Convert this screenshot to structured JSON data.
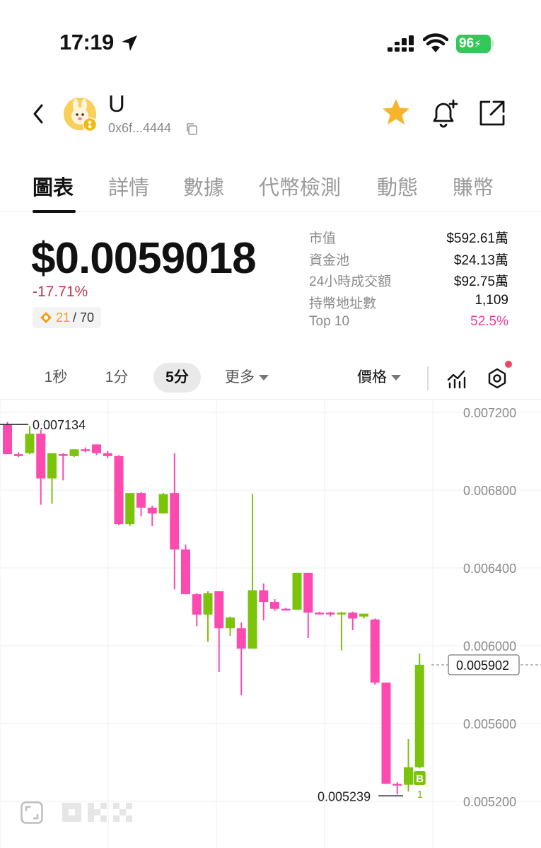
{
  "status_bar": {
    "time": "17:19",
    "battery": "96"
  },
  "token": {
    "name": "U",
    "address": "0x6f...4444"
  },
  "tabs": [
    {
      "label": "圖表",
      "active": true
    },
    {
      "label": "詳情"
    },
    {
      "label": "數據"
    },
    {
      "label": "代幣檢測"
    },
    {
      "label": "動態"
    },
    {
      "label": "賺幣"
    }
  ],
  "price": {
    "value": "$0.0059018",
    "change": "-17.71%",
    "score": "21",
    "score_total": "/ 70"
  },
  "stats": [
    {
      "label": "市值",
      "value": "$592.61萬"
    },
    {
      "label": "資金池",
      "value": "$24.13萬"
    },
    {
      "label": "24小時成交額",
      "value": "$92.75萬"
    },
    {
      "label": "持幣地址數",
      "value": "1,109"
    },
    {
      "label": "Top 10",
      "value": "52.5%",
      "highlight": true
    }
  ],
  "toolbar": {
    "timeframes": [
      "1秒",
      "1分",
      "5分"
    ],
    "active_timeframe": "5分",
    "more_label": "更多",
    "price_label": "價格"
  },
  "colors": {
    "up": "#7cc30c",
    "down": "#fc4ab1",
    "accent_star": "#f7b52c"
  },
  "chart_data": {
    "type": "candlestick",
    "y_ticks": [
      "0.007200",
      "0.006800",
      "0.006400",
      "0.006000",
      "0.005600",
      "0.005200"
    ],
    "ylim": [
      0.00505,
      0.00727
    ],
    "high_label": "0.007134",
    "low_label": "0.005239",
    "last_price_label": "0.005902",
    "marker_label": "B",
    "marker_count": "1",
    "candles": [
      {
        "o": 0.00714,
        "h": 0.00715,
        "c": 0.006985,
        "l": 0.006985,
        "dir": "down"
      },
      {
        "o": 0.006985,
        "h": 0.006995,
        "c": 0.006975,
        "l": 0.00697,
        "dir": "down"
      },
      {
        "o": 0.00699,
        "h": 0.00713,
        "c": 0.00709,
        "l": 0.006985,
        "dir": "up"
      },
      {
        "o": 0.00709,
        "h": 0.00711,
        "c": 0.00686,
        "l": 0.006725,
        "dir": "down"
      },
      {
        "o": 0.00686,
        "h": 0.00699,
        "c": 0.00699,
        "l": 0.00673,
        "dir": "up"
      },
      {
        "o": 0.006985,
        "h": 0.00699,
        "c": 0.00698,
        "l": 0.00685,
        "dir": "down"
      },
      {
        "o": 0.006975,
        "h": 0.00701,
        "c": 0.00701,
        "l": 0.00697,
        "dir": "up"
      },
      {
        "o": 0.00701,
        "h": 0.00702,
        "c": 0.007005,
        "l": 0.006995,
        "dir": "down"
      },
      {
        "o": 0.007035,
        "h": 0.007035,
        "c": 0.00699,
        "l": 0.00698,
        "dir": "down"
      },
      {
        "o": 0.00699,
        "h": 0.007,
        "c": 0.006975,
        "l": 0.006965,
        "dir": "down"
      },
      {
        "o": 0.006975,
        "h": 0.00698,
        "c": 0.006625,
        "l": 0.00662,
        "dir": "down"
      },
      {
        "o": 0.006625,
        "h": 0.006785,
        "c": 0.006785,
        "l": 0.006615,
        "dir": "up"
      },
      {
        "o": 0.006785,
        "h": 0.00679,
        "c": 0.00671,
        "l": 0.006665,
        "dir": "down"
      },
      {
        "o": 0.00671,
        "h": 0.00672,
        "c": 0.00668,
        "l": 0.006615,
        "dir": "down"
      },
      {
        "o": 0.00668,
        "h": 0.006785,
        "c": 0.00678,
        "l": 0.00668,
        "dir": "up"
      },
      {
        "o": 0.006785,
        "h": 0.00699,
        "c": 0.006495,
        "l": 0.00629,
        "dir": "down"
      },
      {
        "o": 0.006495,
        "h": 0.00652,
        "c": 0.006265,
        "l": 0.006265,
        "dir": "down"
      },
      {
        "o": 0.006265,
        "h": 0.00627,
        "c": 0.00616,
        "l": 0.0061,
        "dir": "down"
      },
      {
        "o": 0.00616,
        "h": 0.00628,
        "c": 0.00627,
        "l": 0.00602,
        "dir": "up"
      },
      {
        "o": 0.00628,
        "h": 0.00628,
        "c": 0.00609,
        "l": 0.005865,
        "dir": "down"
      },
      {
        "o": 0.00609,
        "h": 0.00615,
        "c": 0.006145,
        "l": 0.00605,
        "dir": "up"
      },
      {
        "o": 0.00609,
        "h": 0.00612,
        "c": 0.005985,
        "l": 0.005745,
        "dir": "down"
      },
      {
        "o": 0.005985,
        "h": 0.00678,
        "c": 0.006285,
        "l": 0.005985,
        "dir": "up"
      },
      {
        "o": 0.006285,
        "h": 0.00632,
        "c": 0.006225,
        "l": 0.00613,
        "dir": "down"
      },
      {
        "o": 0.006225,
        "h": 0.00624,
        "c": 0.00619,
        "l": 0.00618,
        "dir": "down"
      },
      {
        "o": 0.00619,
        "h": 0.006195,
        "c": 0.006185,
        "l": 0.00618,
        "dir": "down"
      },
      {
        "o": 0.006185,
        "h": 0.006375,
        "c": 0.006375,
        "l": 0.006185,
        "dir": "up"
      },
      {
        "o": 0.006375,
        "h": 0.006375,
        "c": 0.00617,
        "l": 0.00604,
        "dir": "down"
      },
      {
        "o": 0.00617,
        "h": 0.006175,
        "c": 0.006165,
        "l": 0.00616,
        "dir": "down"
      },
      {
        "o": 0.00617,
        "h": 0.006175,
        "c": 0.006165,
        "l": 0.00615,
        "dir": "down"
      },
      {
        "o": 0.006165,
        "h": 0.006175,
        "c": 0.00617,
        "l": 0.005975,
        "dir": "up"
      },
      {
        "o": 0.00617,
        "h": 0.006175,
        "c": 0.00614,
        "l": 0.00608,
        "dir": "down"
      },
      {
        "o": 0.00615,
        "h": 0.006165,
        "c": 0.006165,
        "l": 0.00614,
        "dir": "up"
      },
      {
        "o": 0.006135,
        "h": 0.00614,
        "c": 0.00581,
        "l": 0.0058,
        "dir": "down"
      },
      {
        "o": 0.00581,
        "h": 0.00581,
        "c": 0.00529,
        "l": 0.00529,
        "dir": "down"
      },
      {
        "o": 0.00529,
        "h": 0.0053,
        "c": 0.005285,
        "l": 0.005235,
        "dir": "down"
      },
      {
        "o": 0.005285,
        "h": 0.00552,
        "c": 0.005375,
        "l": 0.00525,
        "dir": "up"
      },
      {
        "o": 0.005375,
        "h": 0.00596,
        "c": 0.005902,
        "l": 0.00537,
        "dir": "up"
      }
    ]
  }
}
